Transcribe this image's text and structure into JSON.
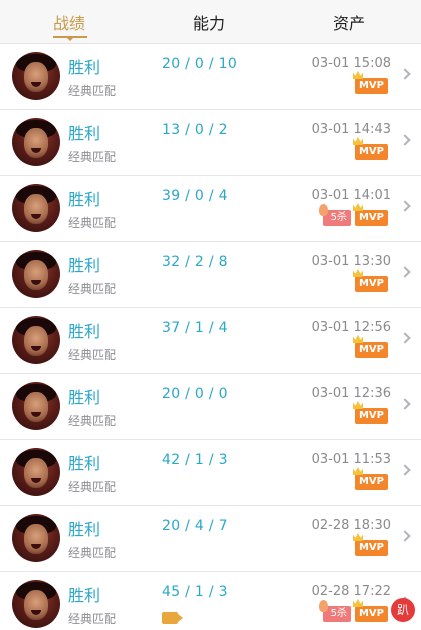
{
  "tabs": [
    {
      "label": "战绩",
      "active": true
    },
    {
      "label": "能力",
      "active": false
    },
    {
      "label": "资产",
      "active": false
    }
  ],
  "colors": {
    "accent": "#c89a4a",
    "result": "#2aa7c9",
    "mvp": "#f3862a",
    "kill": "#f07a7a"
  },
  "matches": [
    {
      "result": "胜利",
      "mode": "经典匹配",
      "kda": "20 / 0 / 10",
      "time": "03-01 15:08",
      "badges": [
        "MVP"
      ]
    },
    {
      "result": "胜利",
      "mode": "经典匹配",
      "kda": "13 / 0 / 2",
      "time": "03-01 14:43",
      "badges": [
        "MVP"
      ]
    },
    {
      "result": "胜利",
      "mode": "经典匹配",
      "kda": "39 / 0 / 4",
      "time": "03-01 14:01",
      "badges": [
        "5杀",
        "MVP"
      ]
    },
    {
      "result": "胜利",
      "mode": "经典匹配",
      "kda": "32 / 2 / 8",
      "time": "03-01 13:30",
      "badges": [
        "MVP"
      ]
    },
    {
      "result": "胜利",
      "mode": "经典匹配",
      "kda": "37 / 1 / 4",
      "time": "03-01 12:56",
      "badges": [
        "MVP"
      ]
    },
    {
      "result": "胜利",
      "mode": "经典匹配",
      "kda": "20 / 0 / 0",
      "time": "03-01 12:36",
      "badges": [
        "MVP"
      ]
    },
    {
      "result": "胜利",
      "mode": "经典匹配",
      "kda": "42 / 1 / 3",
      "time": "03-01 11:53",
      "badges": [
        "MVP"
      ]
    },
    {
      "result": "胜利",
      "mode": "经典匹配",
      "kda": "20 / 4 / 7",
      "time": "02-28 18:30",
      "badges": [
        "MVP"
      ]
    },
    {
      "result": "胜利",
      "mode": "经典匹配",
      "kda": "45 / 1 / 3",
      "time": "02-28 17:22",
      "badges": [
        "5杀",
        "MVP"
      ],
      "video": true
    }
  ],
  "watermark": "趴"
}
